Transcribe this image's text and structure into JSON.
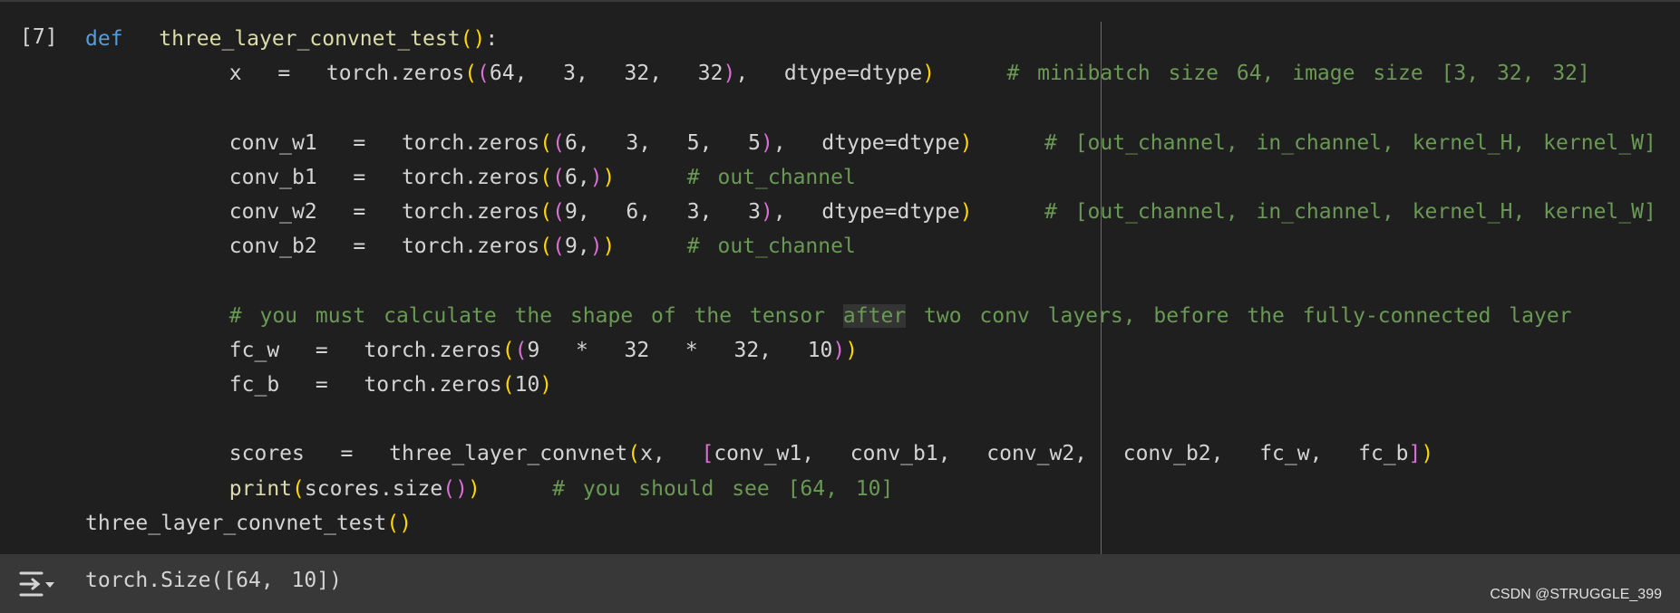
{
  "cell": {
    "execution_count": "[7]",
    "lines": [
      [
        {
          "t": "def",
          "c": "kw"
        },
        {
          "t": "  "
        },
        {
          "t": "three_layer_convnet_test",
          "c": "fn"
        },
        {
          "t": "(",
          "c": "p1"
        },
        {
          "t": ")",
          "c": "p1"
        },
        {
          "t": ":"
        }
      ],
      [
        {
          "t": "        x  =  torch.zeros"
        },
        {
          "t": "(",
          "c": "p1"
        },
        {
          "t": "(",
          "c": "p2"
        },
        {
          "t": "64,  3,  32,  32"
        },
        {
          "t": ")",
          "c": "p2"
        },
        {
          "t": ",  dtype=dtype"
        },
        {
          "t": ")",
          "c": "p1"
        },
        {
          "t": "    # minibatch size 64, image size [3, 32, 32]",
          "c": "cm"
        }
      ],
      [
        {
          "t": ""
        }
      ],
      [
        {
          "t": "        conv_w1  =  torch.zeros"
        },
        {
          "t": "(",
          "c": "p1"
        },
        {
          "t": "(",
          "c": "p2"
        },
        {
          "t": "6,  3,  5,  5"
        },
        {
          "t": ")",
          "c": "p2"
        },
        {
          "t": ",  dtype=dtype"
        },
        {
          "t": ")",
          "c": "p1"
        },
        {
          "t": "    # [out_channel, in_channel, kernel_H, kernel_W]",
          "c": "cm"
        }
      ],
      [
        {
          "t": "        conv_b1  =  torch.zeros"
        },
        {
          "t": "(",
          "c": "p1"
        },
        {
          "t": "(",
          "c": "p2"
        },
        {
          "t": "6,"
        },
        {
          "t": ")",
          "c": "p2"
        },
        {
          "t": ")",
          "c": "p1"
        },
        {
          "t": "    # out_channel",
          "c": "cm"
        }
      ],
      [
        {
          "t": "        conv_w2  =  torch.zeros"
        },
        {
          "t": "(",
          "c": "p1"
        },
        {
          "t": "(",
          "c": "p2"
        },
        {
          "t": "9,  6,  3,  3"
        },
        {
          "t": ")",
          "c": "p2"
        },
        {
          "t": ",  dtype=dtype"
        },
        {
          "t": ")",
          "c": "p1"
        },
        {
          "t": "    # [out_channel, in_channel, kernel_H, kernel_W]",
          "c": "cm"
        }
      ],
      [
        {
          "t": "        conv_b2  =  torch.zeros"
        },
        {
          "t": "(",
          "c": "p1"
        },
        {
          "t": "(",
          "c": "p2"
        },
        {
          "t": "9,"
        },
        {
          "t": ")",
          "c": "p2"
        },
        {
          "t": ")",
          "c": "p1"
        },
        {
          "t": "    # out_channel",
          "c": "cm"
        }
      ],
      [
        {
          "t": ""
        }
      ],
      [
        {
          "t": "        "
        },
        {
          "t": "# you must calculate the shape of the tensor ",
          "c": "cm"
        },
        {
          "t": "after",
          "c": "cm hl"
        },
        {
          "t": " two conv layers, before the fully-connected layer",
          "c": "cm"
        }
      ],
      [
        {
          "t": "        fc_w  =  torch.zeros"
        },
        {
          "t": "(",
          "c": "p1"
        },
        {
          "t": "(",
          "c": "p2"
        },
        {
          "t": "9  *  32  *  32,  10"
        },
        {
          "t": ")",
          "c": "p2"
        },
        {
          "t": ")",
          "c": "p1"
        }
      ],
      [
        {
          "t": "        fc_b  =  torch.zeros"
        },
        {
          "t": "(",
          "c": "p1"
        },
        {
          "t": "10"
        },
        {
          "t": ")",
          "c": "p1"
        }
      ],
      [
        {
          "t": ""
        }
      ],
      [
        {
          "t": "        scores  =  three_layer_convnet"
        },
        {
          "t": "(",
          "c": "p1"
        },
        {
          "t": "x,  "
        },
        {
          "t": "[",
          "c": "p2"
        },
        {
          "t": "conv_w1,  conv_b1,  conv_w2,  conv_b2,  fc_w,  fc_b"
        },
        {
          "t": "]",
          "c": "p2"
        },
        {
          "t": ")",
          "c": "p1"
        }
      ],
      [
        {
          "t": "        "
        },
        {
          "t": "print",
          "c": "fn"
        },
        {
          "t": "(",
          "c": "p1"
        },
        {
          "t": "scores.size"
        },
        {
          "t": "(",
          "c": "p2"
        },
        {
          "t": ")",
          "c": "p2"
        },
        {
          "t": ")",
          "c": "p1"
        },
        {
          "t": "    # you should see [64, 10]",
          "c": "cm"
        }
      ],
      [
        {
          "t": "three_layer_convnet_test"
        },
        {
          "t": "(",
          "c": "p1"
        },
        {
          "t": ")",
          "c": "p1"
        }
      ]
    ]
  },
  "output": {
    "icon": "output-options-icon",
    "text": "torch.Size([64, 10])"
  },
  "watermark": "CSDN @STRUGGLE_399"
}
